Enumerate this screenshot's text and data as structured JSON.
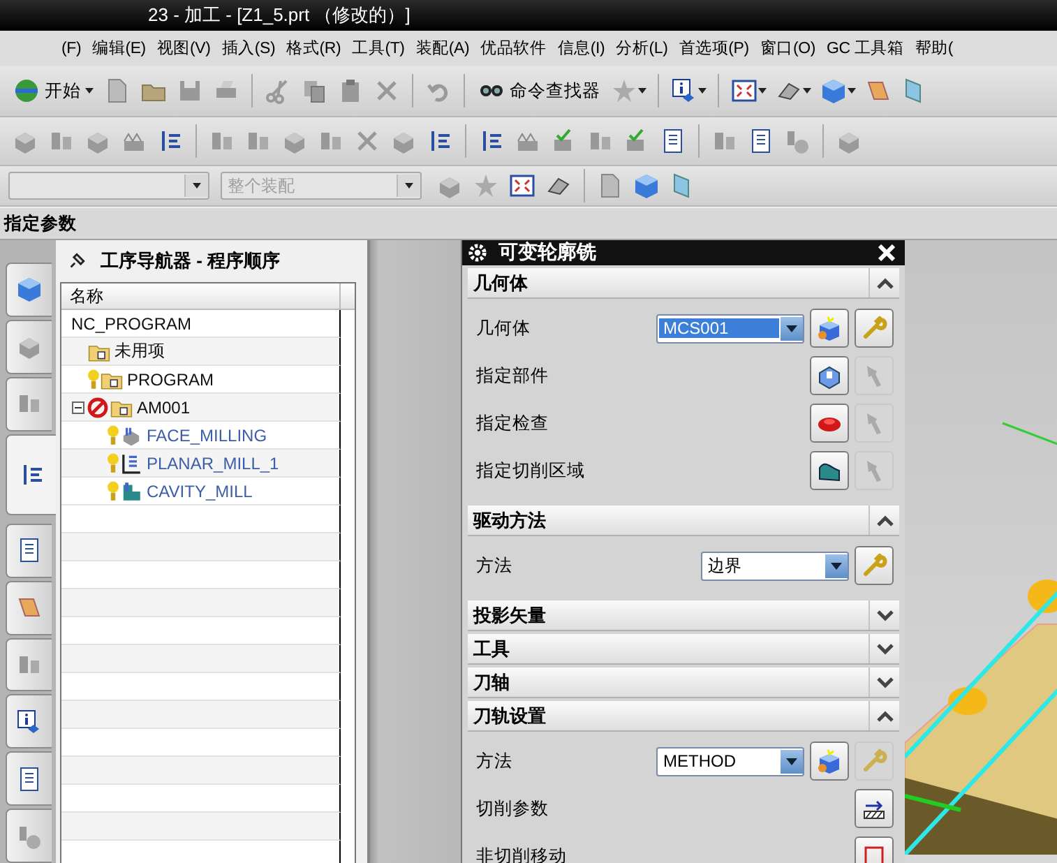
{
  "window": {
    "title": "23 - 加工 - [Z1_5.prt （修改的）]"
  },
  "menu": [
    "(F)",
    "编辑(E)",
    "视图(V)",
    "插入(S)",
    "格式(R)",
    "工具(T)",
    "装配(A)",
    "优品软件",
    "信息(I)",
    "分析(L)",
    "首选项(P)",
    "窗口(O)",
    "GC 工具箱",
    "帮助("
  ],
  "toolbar": {
    "start_button": "开始",
    "command_finder": "命令查找器"
  },
  "selection_bar": {
    "assembly_filter": {
      "value": "整个装配",
      "disabled": true
    }
  },
  "cue_line": "指定参数",
  "side_tabs": [
    {
      "selected": false
    },
    {
      "selected": false
    },
    {
      "selected": false
    },
    {
      "selected": true
    },
    {
      "selected": false
    },
    {
      "selected": false
    },
    {
      "selected": false
    },
    {
      "selected": false
    },
    {
      "selected": false
    },
    {
      "selected": false
    }
  ],
  "navigator": {
    "title": "工序导航器 - 程序顺序",
    "columns": [
      "名称"
    ],
    "tree": [
      {
        "name": "NC_PROGRAM",
        "kind": "root",
        "regen": false,
        "blocked": false,
        "children": [
          {
            "name": "未用项",
            "kind": "group",
            "regen": false,
            "blocked": false
          },
          {
            "name": "PROGRAM",
            "kind": "group",
            "regen": true,
            "blocked": false
          },
          {
            "name": "AM001",
            "kind": "group",
            "regen": false,
            "blocked": true,
            "expanded": true,
            "children": [
              {
                "name": "FACE_MILLING",
                "kind": "face",
                "regen": true,
                "blocked": false
              },
              {
                "name": "PLANAR_MILL_1",
                "kind": "planar",
                "regen": true,
                "blocked": false
              },
              {
                "name": "CAVITY_MILL",
                "kind": "cavity",
                "regen": true,
                "blocked": false
              }
            ]
          }
        ]
      }
    ]
  },
  "dialog": {
    "title": "可变轮廓铣",
    "sections": [
      {
        "title": "几何体",
        "expanded": true,
        "rows": [
          {
            "label": "几何体",
            "select": {
              "value": "MCS001",
              "highlighted": true
            },
            "buttons": [
              {
                "kind": "create",
                "disabled": false
              },
              {
                "kind": "edit",
                "disabled": false
              }
            ]
          },
          {
            "label": "指定部件",
            "buttons": [
              {
                "kind": "part",
                "disabled": false
              },
              {
                "kind": "display",
                "disabled": true
              }
            ]
          },
          {
            "label": "指定检查",
            "buttons": [
              {
                "kind": "check",
                "disabled": false
              },
              {
                "kind": "display",
                "disabled": true
              }
            ]
          },
          {
            "label": "指定切削区域",
            "buttons": [
              {
                "kind": "region",
                "disabled": false
              },
              {
                "kind": "display",
                "disabled": true
              }
            ]
          }
        ]
      },
      {
        "title": "驱动方法",
        "expanded": true,
        "rows": [
          {
            "label": "方法",
            "select": {
              "value": "边界",
              "highlighted": false
            },
            "buttons": [
              {
                "kind": "edit",
                "disabled": false
              }
            ]
          }
        ]
      },
      {
        "title": "投影矢量",
        "expanded": false
      },
      {
        "title": "工具",
        "expanded": false
      },
      {
        "title": "刀轴",
        "expanded": false
      },
      {
        "title": "刀轨设置",
        "expanded": true,
        "rows": [
          {
            "label": "方法",
            "select": {
              "value": "METHOD",
              "highlighted": false
            },
            "buttons": [
              {
                "kind": "create",
                "disabled": false
              },
              {
                "kind": "edit",
                "disabled": true
              }
            ]
          },
          {
            "label": "切削参数",
            "buttons": [
              {
                "kind": "params",
                "disabled": false
              }
            ]
          },
          {
            "label": "非切削移动",
            "buttons": [
              {
                "kind": "moves",
                "disabled": false
              }
            ]
          }
        ]
      }
    ]
  }
}
